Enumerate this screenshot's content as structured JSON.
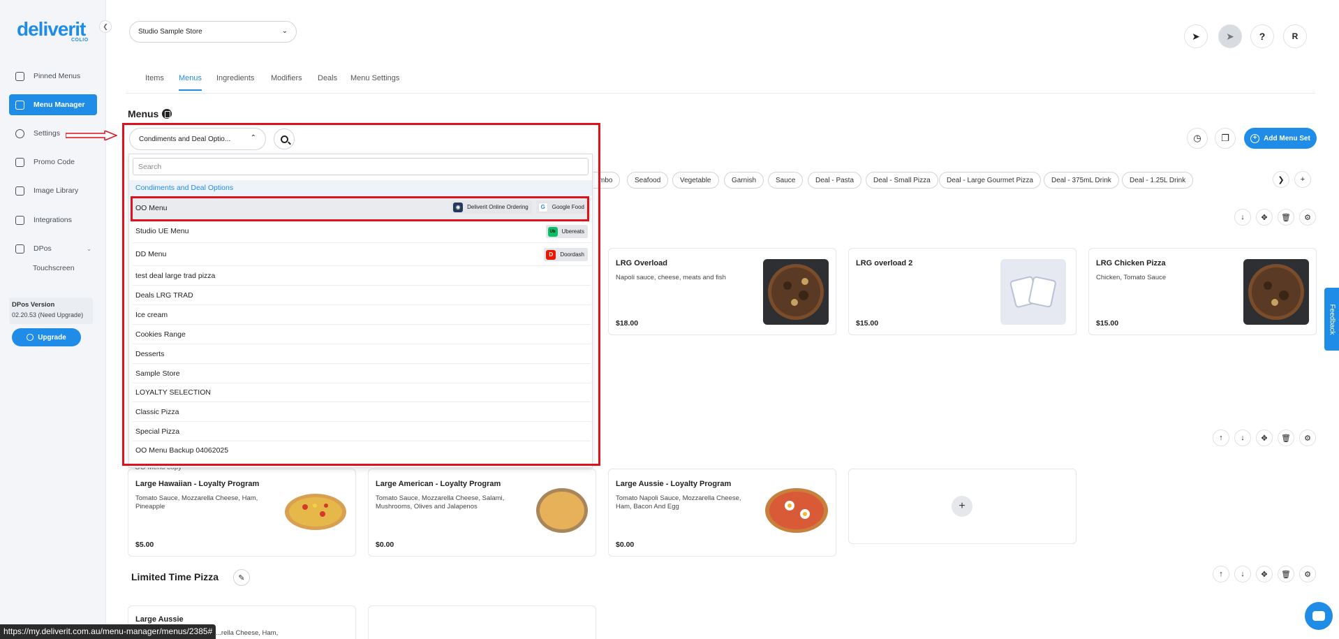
{
  "brand": {
    "name": "deliverit",
    "sub": "COLIO",
    "accent": "#1f8de8"
  },
  "sidebar": {
    "items": [
      {
        "label": "Pinned Menus",
        "icon": "pin-icon"
      },
      {
        "label": "Menu Manager",
        "icon": "menu-icon",
        "active": true
      },
      {
        "label": "Settings",
        "icon": "gear-icon"
      },
      {
        "label": "Promo Code",
        "icon": "tag-icon"
      },
      {
        "label": "Image Library",
        "icon": "image-icon"
      },
      {
        "label": "Integrations",
        "icon": "plug-icon"
      },
      {
        "label": "DPos",
        "icon": "pos-icon"
      }
    ],
    "dpos_sub": "Touchscreen",
    "version_title": "DPos Version",
    "version_value": "02.20.53 (Need Upgrade)",
    "upgrade_label": "Upgrade"
  },
  "header": {
    "store_name": "Studio Sample Store",
    "avatar_initial": "R",
    "help_label": "?"
  },
  "tabs": [
    "Items",
    "Menus",
    "Ingredients",
    "Modifiers",
    "Deals",
    "Menu Settings"
  ],
  "main": {
    "heading": "Menus",
    "selected_menu": "Condiments and Deal Optio...",
    "add_menu_set": "Add Menu Set",
    "chips": [
      "mbo",
      "Seafood",
      "Vegetable",
      "Garnish",
      "Sauce",
      "Deal - Pasta",
      "Deal - Small Pizza",
      "Deal - Large Gourmet Pizza",
      "Deal - 375mL Drink",
      "Deal - 1.25L Drink"
    ]
  },
  "dropdown": {
    "search_placeholder": "Search",
    "group": "Condiments and Deal Options",
    "items": [
      {
        "label": "OO Menu",
        "badges": [
          "Deliverit Online Ordering",
          "Google Food"
        ],
        "selected": true
      },
      {
        "label": "Studio UE Menu",
        "badges": [
          "Ubereats"
        ]
      },
      {
        "label": "DD Menu",
        "badges": [
          "Doordash"
        ]
      },
      {
        "label": "test deal large trad pizza"
      },
      {
        "label": "Deals LRG TRAD"
      },
      {
        "label": "Ice cream"
      },
      {
        "label": "Cookies Range"
      },
      {
        "label": "Desserts"
      },
      {
        "label": "Sample Store"
      },
      {
        "label": "LOYALTY SELECTION"
      },
      {
        "label": "Classic Pizza"
      },
      {
        "label": "Special Pizza"
      },
      {
        "label": "OO Menu Backup 04062025"
      }
    ],
    "cut_off": "OO Menu copy"
  },
  "cards_row1": [
    {
      "title": "LRG Overload",
      "desc": "Napoli sauce, cheese, meats and fish",
      "price": "$18.00"
    },
    {
      "title": "LRG overload 2",
      "desc": "",
      "price": "$15.00"
    },
    {
      "title": "LRG Chicken Pizza",
      "desc": "Chicken, Tomato Sauce",
      "price": "$15.00"
    }
  ],
  "cards_row2": [
    {
      "title": "Large Hawaiian - Loyalty Program",
      "desc": "Tomato Sauce, Mozzarella Cheese, Ham, Pineapple",
      "price": "$5.00"
    },
    {
      "title": "Large American - Loyalty Program",
      "desc": "Tomato Sauce, Mozzarella Cheese, Salami, Mushrooms, Olives and Jalapenos",
      "price": "$0.00"
    },
    {
      "title": "Large Aussie - Loyalty Program",
      "desc": "Tomato Napoli Sauce, Mozzarella Cheese, Ham, Bacon And Egg",
      "price": "$0.00"
    }
  ],
  "section3": {
    "title": "Limited Time Pizza",
    "card_title": "Large Aussie",
    "card_desc": "...rella Cheese, Ham,"
  },
  "status_url": "https://my.deliverit.com.au/menu-manager/menus/2385#",
  "feedback": "Feedback"
}
